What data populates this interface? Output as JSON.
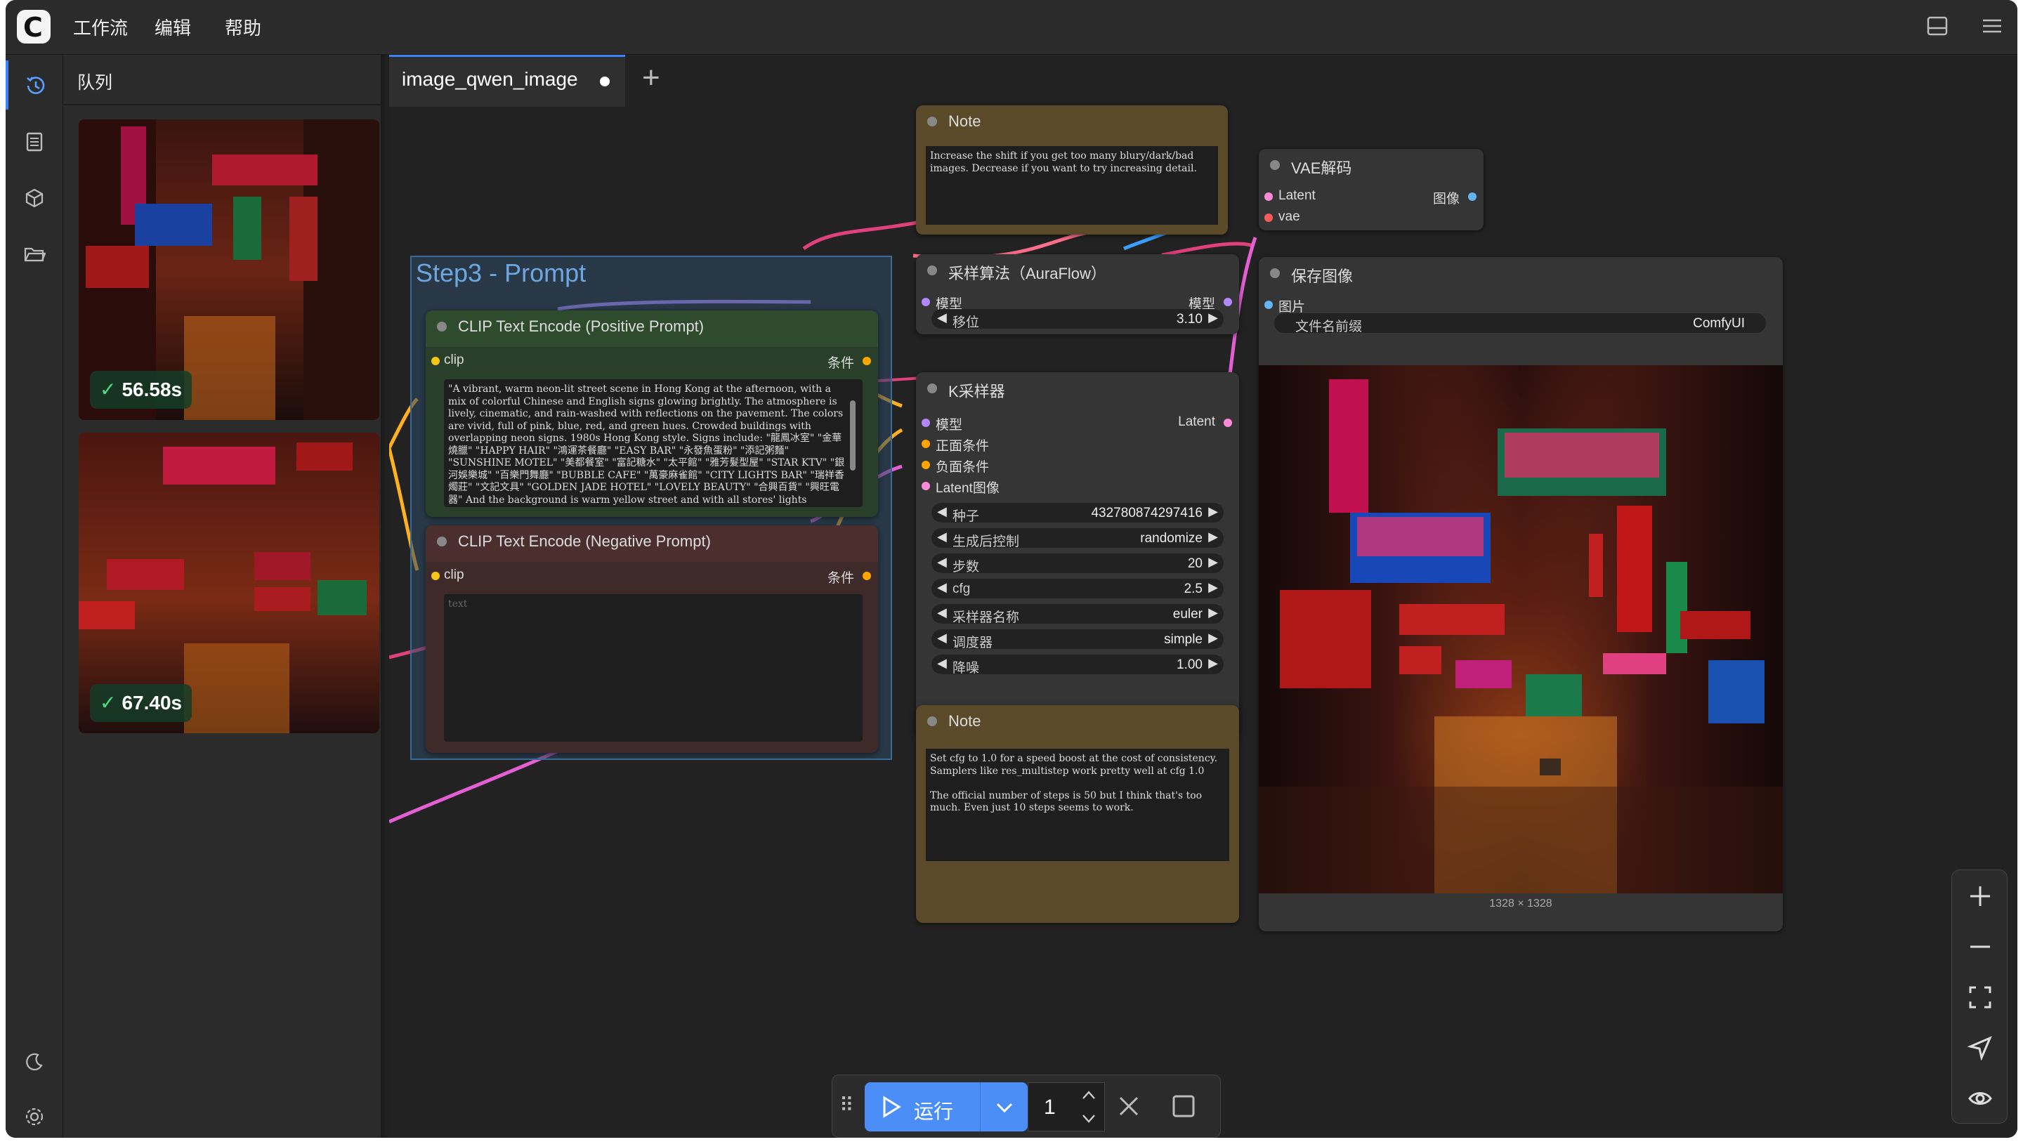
{
  "menu": {
    "workflow": "工作流",
    "edit": "编辑",
    "help": "帮助"
  },
  "queue": {
    "title": "队列",
    "items": [
      {
        "time": "56.58s"
      },
      {
        "time": "67.40s"
      }
    ]
  },
  "tab": {
    "label": "image_qwen_image"
  },
  "group": {
    "title": "Step3 - Prompt"
  },
  "nodes": {
    "note1": {
      "title": "Note",
      "text": "Increase the shift if you get too many blury/dark/bad images. Decrease if you want to try increasing detail."
    },
    "vae_decode": {
      "title": "VAE解码",
      "in_latent": "Latent",
      "in_vae": "vae",
      "out_image": "图像"
    },
    "sampling": {
      "title": "采样算法（AuraFlow）",
      "in_model": "模型",
      "out_model": "模型",
      "shift_label": "移位",
      "shift_value": "3.10"
    },
    "save_image": {
      "title": "保存图像",
      "in_images": "图片",
      "prefix_label": "文件名前缀",
      "prefix_value": "ComfyUI",
      "dims": "1328 × 1328"
    },
    "clip_pos": {
      "title": "CLIP Text Encode (Positive Prompt)",
      "in_clip": "clip",
      "out_cond": "条件",
      "text": "\"A vibrant, warm neon-lit street scene in Hong Kong at the afternoon, with a mix of colorful Chinese and English signs glowing brightly. The atmosphere is lively, cinematic, and rain-washed with reflections on the pavement. The colors are vivid, full of pink, blue, red, and green hues. Crowded buildings with overlapping neon signs. 1980s Hong Kong style. Signs include: \"龍鳳冰室\" \"金華燒臘\" \"HAPPY HAIR\" \"鴻運茶餐廳\" \"EASY BAR\" \"永發魚蛋粉\" \"添記粥麵\" \"SUNSHINE MOTEL\" \"美都餐室\" \"富記糖水\" \"太平館\" \"雅芳髮型屋\" \"STAR KTV\" \"銀河娛樂城\" \"百樂門舞廳\" \"BUBBLE CAFE\" \"萬豪麻雀館\" \"CITY LIGHTS BAR\" \"瑞祥香燭莊\" \"文記文具\" \"GOLDEN JADE HOTEL\" \"LOVELY BEAUTY\" \"合興百貨\" \"興旺電器\" And the background is warm yellow street and with all stores' lights"
    },
    "clip_neg": {
      "title": "CLIP Text Encode (Negative Prompt)",
      "in_clip": "clip",
      "out_cond": "条件",
      "placeholder": "text"
    },
    "ksampler": {
      "title": "K采样器",
      "in_model": "模型",
      "in_pos": "正面条件",
      "in_neg": "负面条件",
      "in_latent": "Latent图像",
      "out_latent": "Latent",
      "widgets": [
        {
          "label": "种子",
          "value": "432780874297416"
        },
        {
          "label": "生成后控制",
          "value": "randomize"
        },
        {
          "label": "步数",
          "value": "20"
        },
        {
          "label": "cfg",
          "value": "2.5"
        },
        {
          "label": "采样器名称",
          "value": "euler"
        },
        {
          "label": "调度器",
          "value": "simple"
        },
        {
          "label": "降噪",
          "value": "1.00"
        }
      ]
    },
    "note2": {
      "title": "Note",
      "text": "Set cfg to 1.0 for a speed boost at the cost of consistency. Samplers like res_multistep work pretty well at cfg 1.0\n\nThe official number of steps is 50 but I think that's too much. Even just 10 steps seems to work."
    }
  },
  "runbar": {
    "run_label": "运行",
    "count": "1"
  },
  "icons": [
    "history-icon",
    "document-icon",
    "cube-icon",
    "folder-icon",
    "moon-icon",
    "gear-icon",
    "layout-icon",
    "hamburger-icon",
    "plus-icon",
    "minus-icon",
    "fit-view-icon",
    "navigate-icon",
    "eye-icon",
    "drag-handle-icon",
    "play-icon",
    "chevron-down-icon",
    "chevron-up-icon",
    "close-icon",
    "stop-icon"
  ],
  "colors": {
    "accent": "#4b8ef7",
    "clip_pos_header": "#2a4b2a",
    "clip_neg_header": "#4a2a2a",
    "note": "#5a4a2a",
    "group": "#2e4a66"
  }
}
